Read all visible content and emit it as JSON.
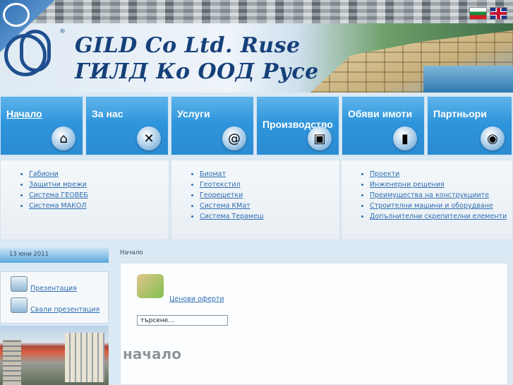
{
  "header": {
    "title_latin": "GILD Co Ltd. Ruse",
    "title_cyrillic": "ГИЛД Ко ООД Русе",
    "registered": "®",
    "flags": [
      "bulgarian-flag-icon",
      "english-flag-icon"
    ]
  },
  "nav": {
    "tiles": [
      {
        "label": "Начало",
        "icon": "house-icon"
      },
      {
        "label": "За нас",
        "icon": "tools-icon"
      },
      {
        "label": "Услуги",
        "icon": "envelope-search-icon"
      },
      {
        "label": "Производство",
        "icon": "photo-icon"
      },
      {
        "label": "Обяви имоти",
        "icon": "server-icon"
      },
      {
        "label": "Партньори",
        "icon": "globe-icon"
      }
    ]
  },
  "sublinks": {
    "col1": [
      "Габиони",
      "Защитни мрежи",
      "Система ГЕОВЕБ",
      "Система МАКОЛ"
    ],
    "col2": [
      "Биомат",
      "Геотекстил",
      "Георешетки",
      "Система КМат",
      "Система Терамеш"
    ],
    "col3": [
      "Проекти",
      "Инженерни решения",
      "Преимущества на конструкциите",
      "Строителни машини и оборудване",
      "Допълнителни скрепителни елементи"
    ]
  },
  "sidebar": {
    "date": "13 юни 2011",
    "items": [
      {
        "label": "Презентация",
        "icon": "presentation-icon"
      },
      {
        "label": "Свали презентация",
        "icon": "download-presentation-icon"
      }
    ]
  },
  "main": {
    "breadcrumb": "Начало",
    "offers_link": "Ценови оферти",
    "search_value": "търсене...",
    "heading": "начало"
  },
  "colors": {
    "nav_blue": "#2f95dc",
    "title_blue": "#16407a",
    "link_blue": "#2e6db0"
  }
}
